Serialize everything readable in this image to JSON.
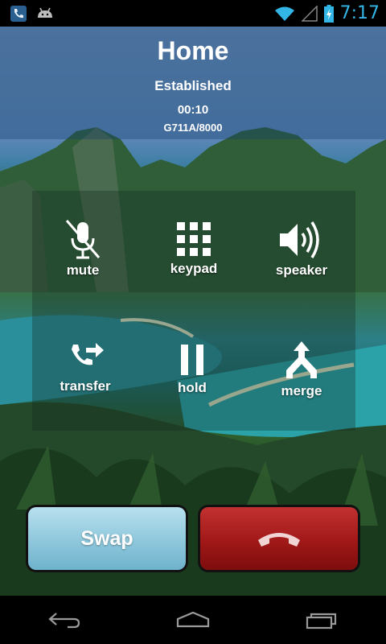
{
  "status_bar": {
    "time": "7:17",
    "icons": [
      "phone-icon",
      "android-icon",
      "wifi-icon",
      "signal-icon",
      "battery-charging-icon"
    ]
  },
  "call": {
    "title": "Home",
    "state": "Established",
    "timer": "00:10",
    "codec": "G711A/8000"
  },
  "controls": {
    "mute": "mute",
    "keypad": "keypad",
    "speaker": "speaker",
    "transfer": "transfer",
    "hold": "hold",
    "merge": "merge"
  },
  "actions": {
    "swap": "Swap"
  },
  "navbar": {
    "icons": [
      "back-icon",
      "home-icon",
      "recent-apps-icon"
    ]
  },
  "colors": {
    "time_accent": "#33b5e5",
    "swap_button": "#8ec7dc",
    "hangup_button": "#a11818"
  }
}
